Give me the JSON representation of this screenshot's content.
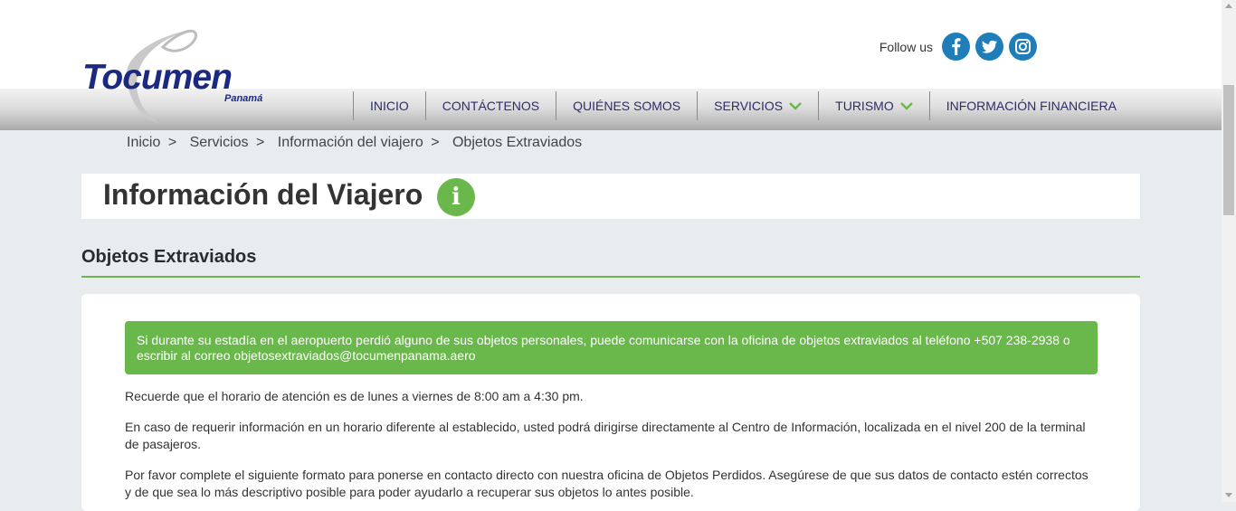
{
  "logo": {
    "word": "Tocumen",
    "sub": "Panamá"
  },
  "social": {
    "label": "Follow us",
    "icons": [
      "facebook-icon",
      "twitter-icon",
      "instagram-icon"
    ],
    "color": "#1f7db9"
  },
  "nav": {
    "items": [
      {
        "label": "INICIO",
        "dropdown": false
      },
      {
        "label": "CONTÁCTENOS",
        "dropdown": false
      },
      {
        "label": "QUIÉNES SOMOS",
        "dropdown": false
      },
      {
        "label": "SERVICIOS",
        "dropdown": true
      },
      {
        "label": "TURISMO",
        "dropdown": true
      },
      {
        "label": "INFORMACIÓN FINANCIERA",
        "dropdown": false
      }
    ]
  },
  "breadcrumb": {
    "items": [
      "Inicio",
      "Servicios",
      "Información del viajero",
      "Objetos Extraviados"
    ],
    "separator": ">"
  },
  "page": {
    "title": "Información del Viajero",
    "icon": "info-icon",
    "section_title": "Objetos Extraviados"
  },
  "content": {
    "alert": "Si durante su estadía en el aeropuerto perdió alguno de sus objetos personales, puede comunicarse con la oficina de objetos extraviados al teléfono +507 238-2938 o escribir al correo objetosextraviados@tocumenpanama.aero",
    "paragraphs": [
      "Recuerde que el horario de atención es de lunes a viernes de 8:00 am a 4:30 pm.",
      "En caso de requerir información en un horario diferente al establecido, usted podrá dirigirse directamente al Centro de Información, localizada en el nivel 200 de la terminal de pasajeros.",
      "Por favor complete el siguiente formato para ponerse en contacto directo con nuestra oficina de Objetos Perdidos. Asegúrese de que sus datos de contacto estén correctos y de que sea lo más descriptivo posible para poder ayudarlo a recuperar sus objetos lo antes posible."
    ]
  },
  "colors": {
    "accent": "#6ab84b",
    "nav_text": "#2c2c6c",
    "brand": "#1b2a80"
  }
}
